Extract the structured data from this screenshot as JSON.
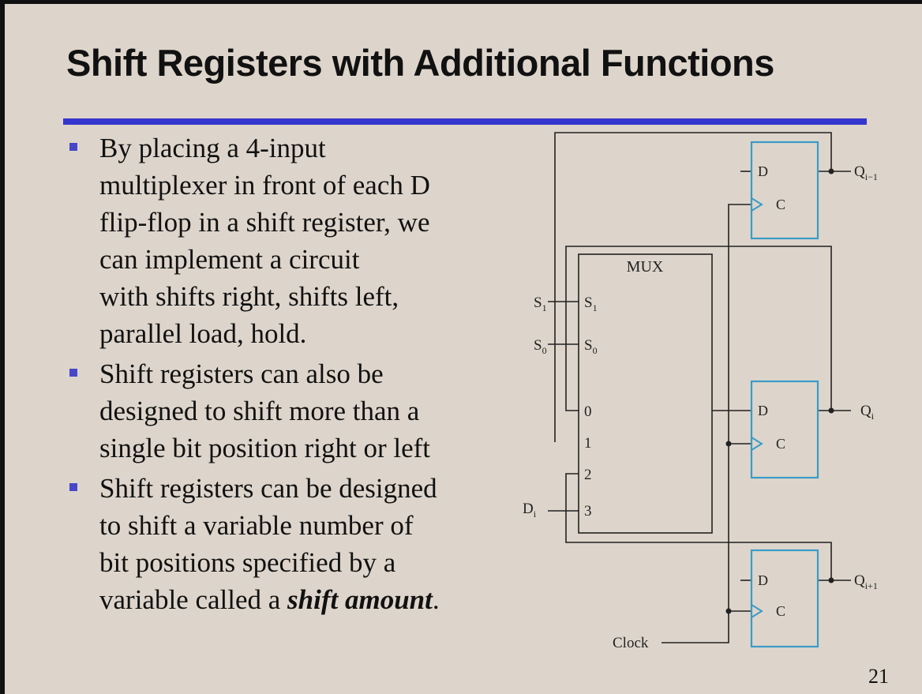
{
  "slide": {
    "title": "Shift Registers with Additional Functions",
    "page_number": "21",
    "bullets": [
      {
        "lines": [
          "By placing a 4-input",
          "multiplexer in front of each D",
          "flip-flop in a shift register, we",
          "can implement a circuit",
          "with shifts right, shifts left,",
          "parallel load, hold."
        ]
      },
      {
        "lines": [
          "Shift registers can also be",
          "designed to shift more than a",
          "single bit position right or left"
        ]
      },
      {
        "lines": [
          "Shift registers can be designed",
          "to shift a variable number of",
          "bit positions specified by a"
        ],
        "last_prefix": "variable called a ",
        "last_emphasis": "shift amount",
        "last_suffix": "."
      }
    ]
  },
  "diagram": {
    "mux_label": "MUX",
    "select_inputs": [
      {
        "name": "S",
        "sub": "1"
      },
      {
        "name": "S",
        "sub": "0"
      }
    ],
    "mux_data_inputs": [
      "0",
      "1",
      "2",
      "3"
    ],
    "data_input": {
      "name": "D",
      "sub": "i"
    },
    "ff_d_label": "D",
    "ff_c_label": "C",
    "outputs": [
      {
        "name": "Q",
        "sub": "i−1"
      },
      {
        "name": "Q",
        "sub": "i"
      },
      {
        "name": "Q",
        "sub": "i+1"
      }
    ],
    "clock_label": "Clock"
  },
  "colors": {
    "background": "#ddd5cb",
    "accent_rule": "#3535cf",
    "bullet": "#4747c8",
    "flipflop": "#3a9bc7",
    "wire": "#222222"
  }
}
